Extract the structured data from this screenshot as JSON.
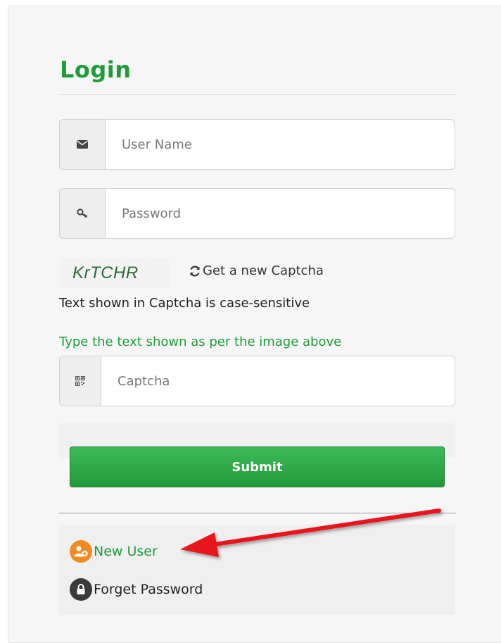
{
  "login": {
    "title": "Login",
    "username_placeholder": "User Name",
    "password_placeholder": "Password",
    "captcha_text": "KrTCHR",
    "refresh_label": "Get a new Captcha",
    "case_note": "Text shown in Captcha is case-sensitive",
    "captcha_hint": "Type the text shown as per the image above",
    "captcha_placeholder": "Captcha",
    "submit_label": "Submit",
    "new_user_label": "New User",
    "forget_password_label": "Forget Password"
  },
  "colors": {
    "accent_green": "#1f9b3a",
    "button_green": "#2faa48",
    "new_user_icon": "#f08a24",
    "lock_icon": "#3a3a3a",
    "arrow_red": "#e8161b"
  },
  "icons": {
    "username": "envelope-icon",
    "password": "key-icon",
    "captcha": "qr-code-icon",
    "refresh": "refresh-icon",
    "new_user": "add-user-icon",
    "forget_password": "lock-icon"
  }
}
